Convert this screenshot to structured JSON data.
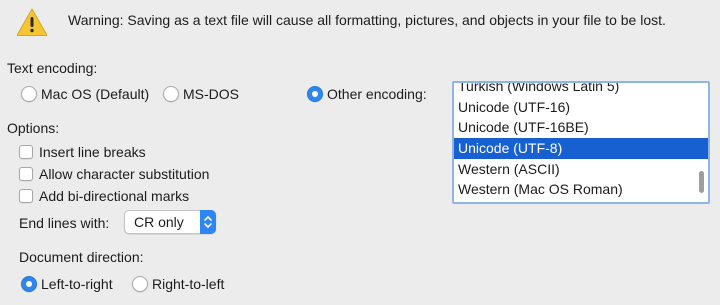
{
  "warning": {
    "text": "Warning: Saving as a text file will cause all formatting, pictures, and objects in your file to be lost."
  },
  "text_encoding": {
    "label": "Text encoding:",
    "options": [
      {
        "label": "Mac OS (Default)",
        "selected": false
      },
      {
        "label": "MS-DOS",
        "selected": false
      },
      {
        "label": "Other encoding:",
        "selected": true
      }
    ],
    "list_items": [
      "Turkish (Windows Latin 5)",
      "Unicode (UTF-16)",
      "Unicode (UTF-16BE)",
      "Unicode (UTF-8)",
      "Western (ASCII)",
      "Western (Mac OS Roman)"
    ],
    "selected_item": "Unicode (UTF-8)"
  },
  "options": {
    "label": "Options:",
    "checkboxes": [
      {
        "label": "Insert line breaks",
        "checked": false
      },
      {
        "label": "Allow character substitution",
        "checked": false
      },
      {
        "label": "Add bi-directional marks",
        "checked": false
      }
    ]
  },
  "end_lines": {
    "label": "End lines with:",
    "value": "CR only"
  },
  "document_direction": {
    "label": "Document direction:",
    "options": [
      {
        "label": "Left-to-right",
        "selected": true
      },
      {
        "label": "Right-to-left",
        "selected": false
      }
    ]
  },
  "colors": {
    "accent": "#2e86f2",
    "selection": "#1660d1",
    "background": "#ececec",
    "warning_icon": "#f6c531"
  }
}
